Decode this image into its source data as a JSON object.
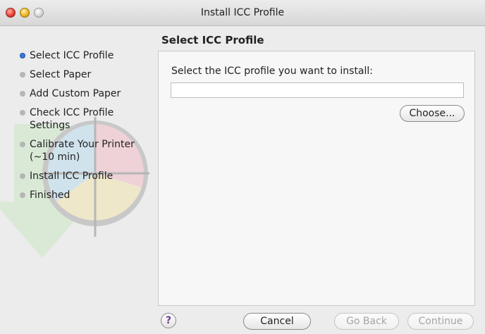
{
  "window": {
    "title": "Install ICC Profile"
  },
  "sidebar": {
    "steps": [
      {
        "label": "Select ICC Profile",
        "state": "current"
      },
      {
        "label": "Select Paper",
        "state": "pending"
      },
      {
        "label": "Add Custom Paper",
        "state": "pending"
      },
      {
        "label": "Check ICC Profile Settings",
        "state": "pending"
      },
      {
        "label": "Calibrate Your Printer (~10 min)",
        "state": "pending"
      },
      {
        "label": "Install ICC Profile",
        "state": "pending"
      },
      {
        "label": "Finished",
        "state": "pending"
      }
    ]
  },
  "main": {
    "title": "Select ICC Profile",
    "prompt": "Select the ICC profile you want to install:",
    "path_value": "",
    "choose_label": "Choose..."
  },
  "footer": {
    "help_label": "?",
    "cancel_label": "Cancel",
    "back_label": "Go Back",
    "continue_label": "Continue"
  },
  "colors": {
    "current_step": "#3c78d8",
    "pending_step": "#b5b5b5"
  },
  "icons": [
    "close-icon",
    "minimize-icon",
    "zoom-icon",
    "help-icon",
    "color-target-icon"
  ]
}
